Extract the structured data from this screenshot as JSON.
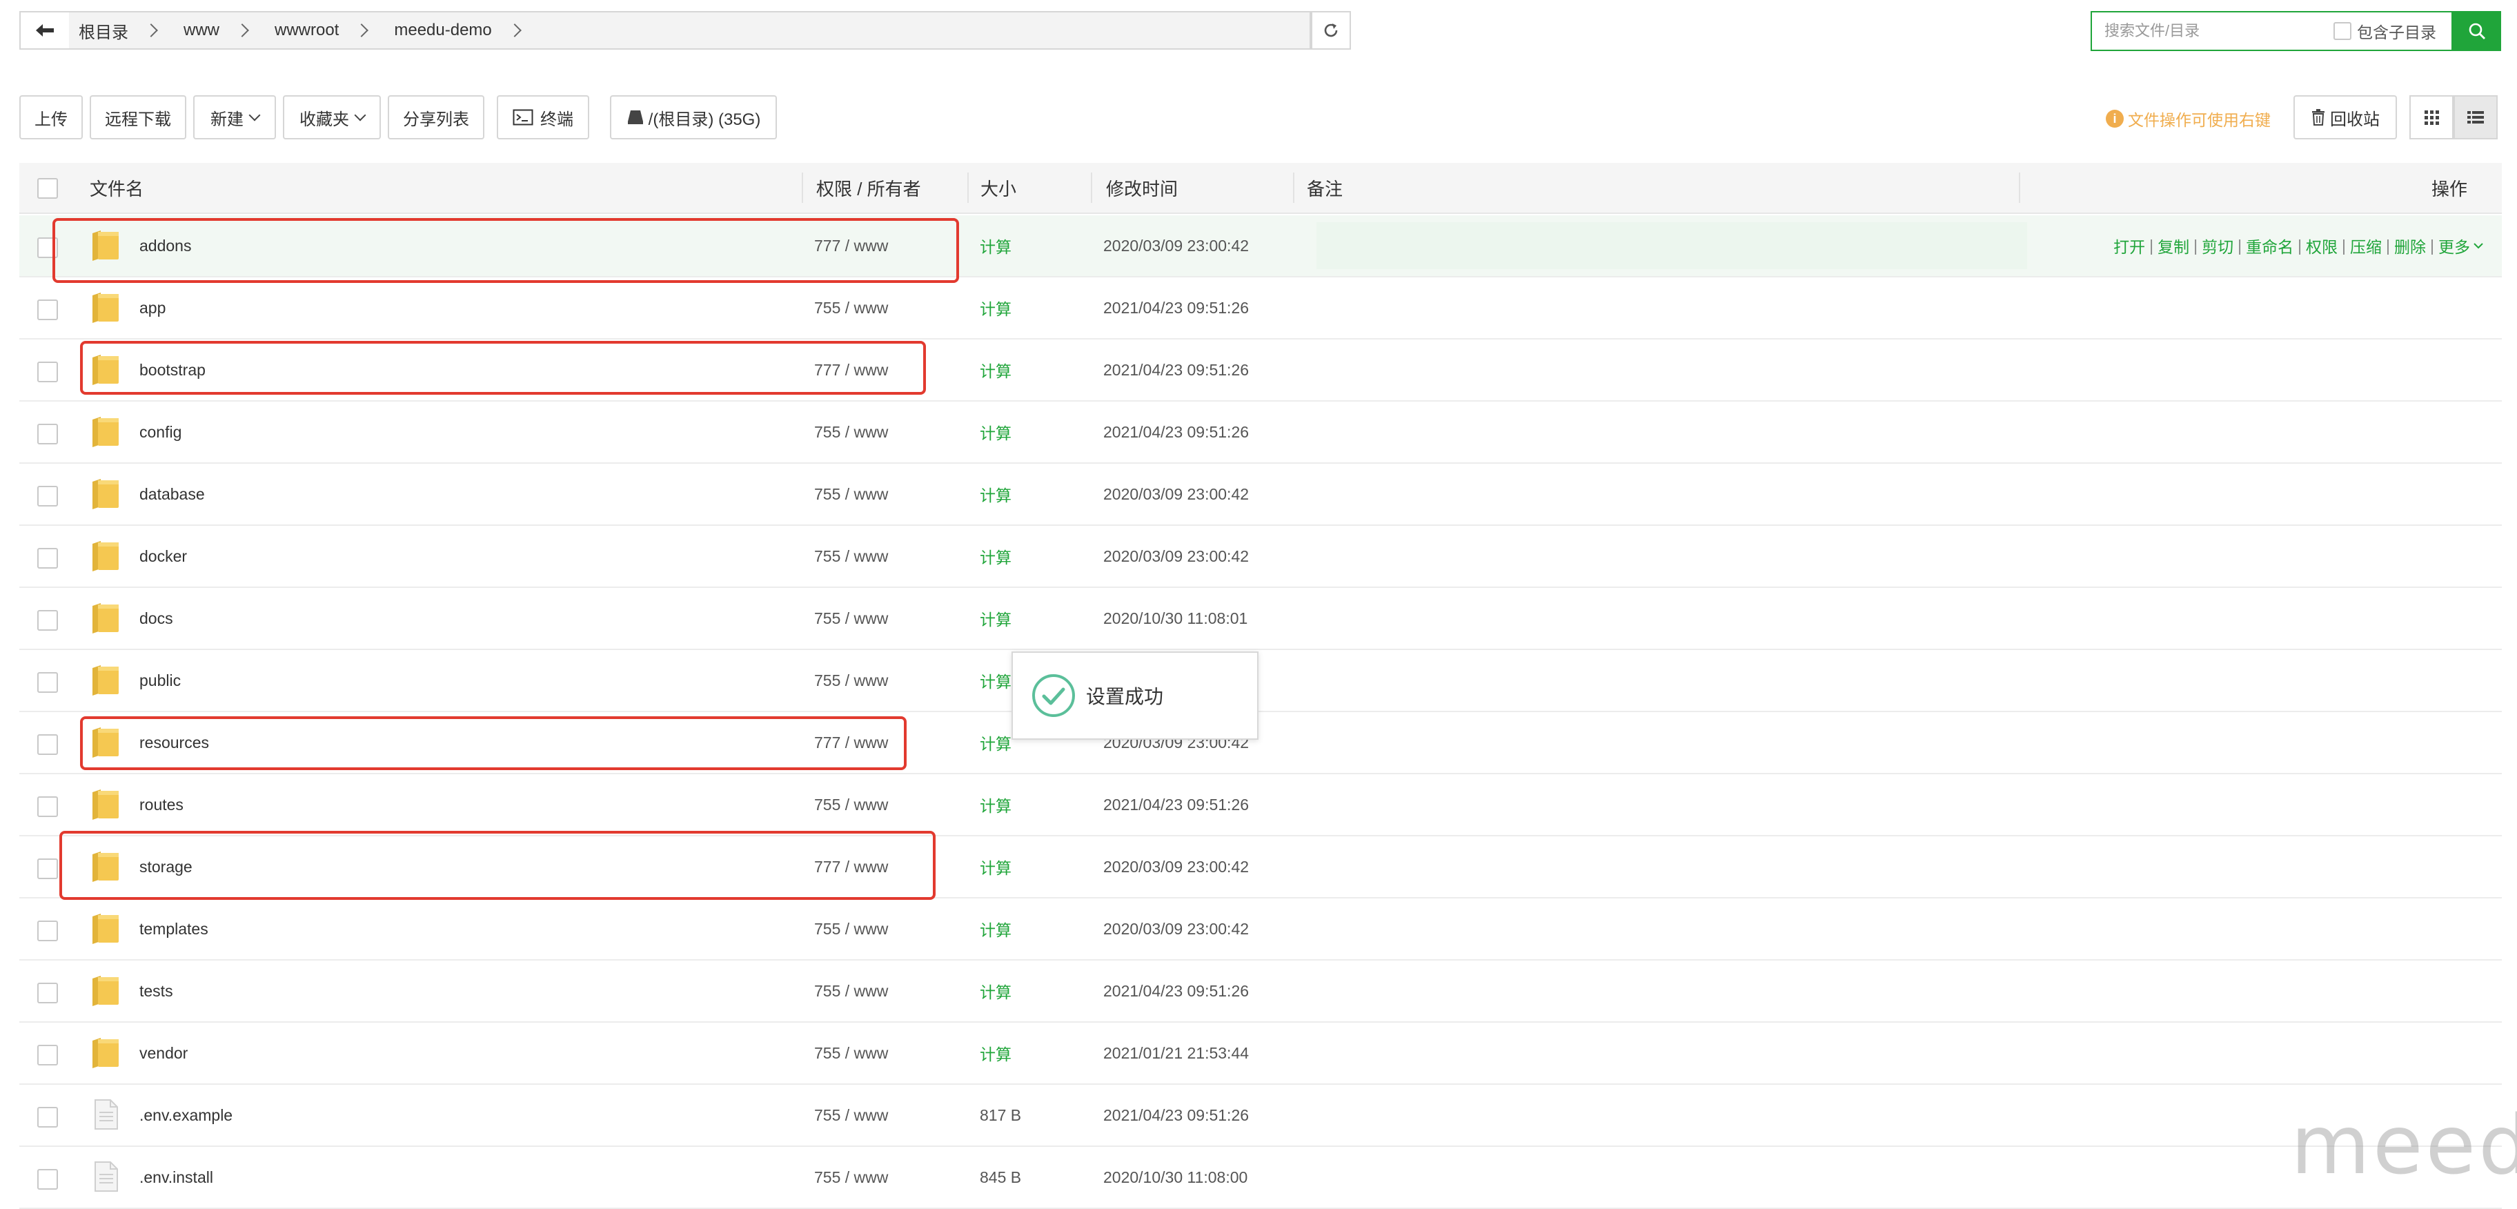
{
  "breadcrumbs": [
    "根目录",
    "www",
    "wwwroot",
    "meedu-demo"
  ],
  "search": {
    "placeholder": "搜索文件/目录",
    "include_subdir_label": "包含子目录"
  },
  "toolbar": {
    "upload": "上传",
    "remote_download": "远程下载",
    "new": "新建",
    "favorites": "收藏夹",
    "share_list": "分享列表",
    "terminal": "终端",
    "disk": "/(根目录) (35G)",
    "tip": "文件操作可使用右键",
    "recycle_bin": "回收站"
  },
  "columns": {
    "name": "文件名",
    "perm": "权限 / 所有者",
    "size": "大小",
    "mtime": "修改时间",
    "remark": "备注",
    "actions": "操作"
  },
  "row_actions": [
    "打开",
    "复制",
    "剪切",
    "重命名",
    "权限",
    "压缩",
    "删除",
    "更多"
  ],
  "rows": [
    {
      "name": "addons",
      "type": "folder",
      "perm": "777 / www",
      "size": "计算",
      "mtime": "2020/03/09 23:00:42"
    },
    {
      "name": "app",
      "type": "folder",
      "perm": "755 / www",
      "size": "计算",
      "mtime": "2021/04/23 09:51:26"
    },
    {
      "name": "bootstrap",
      "type": "folder",
      "perm": "777 / www",
      "size": "计算",
      "mtime": "2021/04/23 09:51:26"
    },
    {
      "name": "config",
      "type": "folder",
      "perm": "755 / www",
      "size": "计算",
      "mtime": "2021/04/23 09:51:26"
    },
    {
      "name": "database",
      "type": "folder",
      "perm": "755 / www",
      "size": "计算",
      "mtime": "2020/03/09 23:00:42"
    },
    {
      "name": "docker",
      "type": "folder",
      "perm": "755 / www",
      "size": "计算",
      "mtime": "2020/03/09 23:00:42"
    },
    {
      "name": "docs",
      "type": "folder",
      "perm": "755 / www",
      "size": "计算",
      "mtime": "2020/10/30 11:08:01"
    },
    {
      "name": "public",
      "type": "folder",
      "perm": "755 / www",
      "size": "计算",
      "mtime": ""
    },
    {
      "name": "resources",
      "type": "folder",
      "perm": "777 / www",
      "size": "计算",
      "mtime": "2020/03/09 23:00:42"
    },
    {
      "name": "routes",
      "type": "folder",
      "perm": "755 / www",
      "size": "计算",
      "mtime": "2021/04/23 09:51:26"
    },
    {
      "name": "storage",
      "type": "folder",
      "perm": "777 / www",
      "size": "计算",
      "mtime": "2020/03/09 23:00:42"
    },
    {
      "name": "templates",
      "type": "folder",
      "perm": "755 / www",
      "size": "计算",
      "mtime": "2020/03/09 23:00:42"
    },
    {
      "name": "tests",
      "type": "folder",
      "perm": "755 / www",
      "size": "计算",
      "mtime": "2021/04/23 09:51:26"
    },
    {
      "name": "vendor",
      "type": "folder",
      "perm": "755 / www",
      "size": "计算",
      "mtime": "2021/01/21 21:53:44"
    },
    {
      "name": ".env.example",
      "type": "file",
      "perm": "755 / www",
      "size": "817 B",
      "mtime": "2021/04/23 09:51:26"
    },
    {
      "name": ".env.install",
      "type": "file",
      "perm": "755 / www",
      "size": "845 B",
      "mtime": "2020/10/30 11:08:00"
    }
  ],
  "toast": {
    "message": "设置成功"
  },
  "watermark": "meedu",
  "colors": {
    "accent_green": "#20a53a",
    "warning_orange": "#f0ad4e",
    "highlight_red": "#e23a2f",
    "folder_yellow": "#f5c851"
  }
}
